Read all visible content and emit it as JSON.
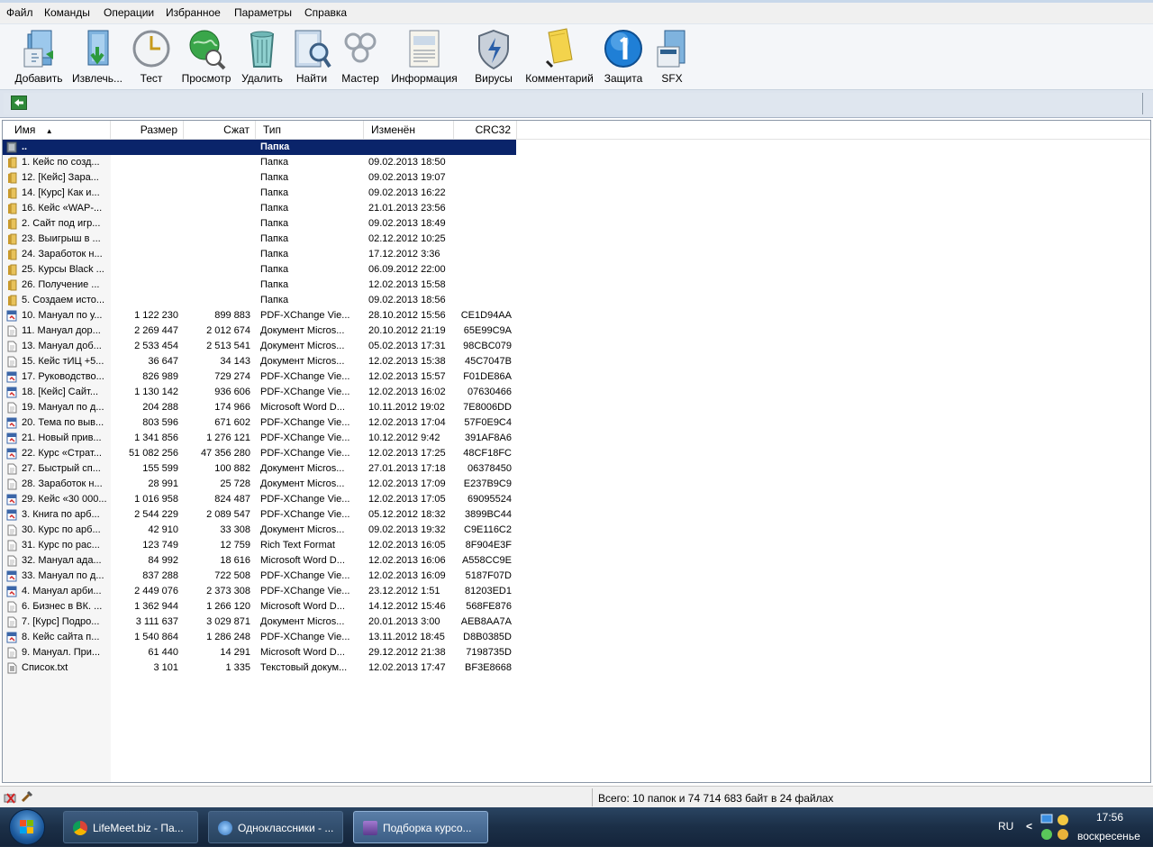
{
  "menu": [
    "Файл",
    "Команды",
    "Операции",
    "Избранное",
    "Параметры",
    "Справка"
  ],
  "toolbar": [
    {
      "label": "Добавить",
      "icon": "add-archive-icon"
    },
    {
      "label": "Извлечь...",
      "icon": "extract-icon"
    },
    {
      "label": "Тест",
      "icon": "test-clock-icon"
    },
    {
      "label": "Просмотр",
      "icon": "view-globe-icon"
    },
    {
      "label": "Удалить",
      "icon": "delete-trash-icon"
    },
    {
      "label": "Найти",
      "icon": "find-binoculars-icon"
    },
    {
      "label": "Мастер",
      "icon": "wizard-icon"
    },
    {
      "label": "Информация",
      "icon": "info-icon"
    },
    {
      "label": "Вирусы",
      "icon": "virus-shield-icon"
    },
    {
      "label": "Комментарий",
      "icon": "comment-icon"
    },
    {
      "label": "Защита",
      "icon": "protect-icon"
    },
    {
      "label": "SFX",
      "icon": "sfx-icon"
    }
  ],
  "columns": {
    "name": "Имя",
    "size": "Размер",
    "packed": "Сжат",
    "type": "Тип",
    "modified": "Изменён",
    "crc": "CRC32"
  },
  "rows": [
    {
      "name": "..",
      "size": "",
      "packed": "",
      "type": "Папка",
      "modified": "",
      "crc": "",
      "icon": "up-folder"
    },
    {
      "name": "1. Кейс по созд...",
      "size": "",
      "packed": "",
      "type": "Папка",
      "modified": "09.02.2013 18:50",
      "crc": "",
      "icon": "folder"
    },
    {
      "name": "12. [Кейс] Зара...",
      "size": "",
      "packed": "",
      "type": "Папка",
      "modified": "09.02.2013 19:07",
      "crc": "",
      "icon": "folder"
    },
    {
      "name": "14. [Курс] Как и...",
      "size": "",
      "packed": "",
      "type": "Папка",
      "modified": "09.02.2013 16:22",
      "crc": "",
      "icon": "folder"
    },
    {
      "name": "16. Кейс «WAP-...",
      "size": "",
      "packed": "",
      "type": "Папка",
      "modified": "21.01.2013 23:56",
      "crc": "",
      "icon": "folder"
    },
    {
      "name": "2. Сайт под игр...",
      "size": "",
      "packed": "",
      "type": "Папка",
      "modified": "09.02.2013 18:49",
      "crc": "",
      "icon": "folder"
    },
    {
      "name": "23. Выигрыш в ...",
      "size": "",
      "packed": "",
      "type": "Папка",
      "modified": "02.12.2012 10:25",
      "crc": "",
      "icon": "folder"
    },
    {
      "name": "24. Заработок н...",
      "size": "",
      "packed": "",
      "type": "Папка",
      "modified": "17.12.2012 3:36",
      "crc": "",
      "icon": "folder"
    },
    {
      "name": "25. Курсы Black ...",
      "size": "",
      "packed": "",
      "type": "Папка",
      "modified": "06.09.2012 22:00",
      "crc": "",
      "icon": "folder"
    },
    {
      "name": "26. Получение ...",
      "size": "",
      "packed": "",
      "type": "Папка",
      "modified": "12.02.2013 15:58",
      "crc": "",
      "icon": "folder"
    },
    {
      "name": "5. Создаем исто...",
      "size": "",
      "packed": "",
      "type": "Папка",
      "modified": "09.02.2013 18:56",
      "crc": "",
      "icon": "folder"
    },
    {
      "name": "10. Мануал по у...",
      "size": "1 122 230",
      "packed": "899 883",
      "type": "PDF-XChange Vie...",
      "modified": "28.10.2012 15:56",
      "crc": "CE1D94AA",
      "icon": "pdf"
    },
    {
      "name": "11. Мануал дор...",
      "size": "2 269 447",
      "packed": "2 012 674",
      "type": "Документ Micros...",
      "modified": "20.10.2012 21:19",
      "crc": "65E99C9A",
      "icon": "doc"
    },
    {
      "name": "13. Мануал доб...",
      "size": "2 533 454",
      "packed": "2 513 541",
      "type": "Документ Micros...",
      "modified": "05.02.2013 17:31",
      "crc": "98CBC079",
      "icon": "doc"
    },
    {
      "name": "15. Кейс тИЦ +5...",
      "size": "36 647",
      "packed": "34 143",
      "type": "Документ Micros...",
      "modified": "12.02.2013 15:38",
      "crc": "45C7047B",
      "icon": "doc"
    },
    {
      "name": "17. Руководство...",
      "size": "826 989",
      "packed": "729 274",
      "type": "PDF-XChange Vie...",
      "modified": "12.02.2013 15:57",
      "crc": "F01DE86A",
      "icon": "pdf"
    },
    {
      "name": "18. [Кейс] Сайт...",
      "size": "1 130 142",
      "packed": "936 606",
      "type": "PDF-XChange Vie...",
      "modified": "12.02.2013 16:02",
      "crc": "07630466",
      "icon": "pdf"
    },
    {
      "name": "19. Мануал по д...",
      "size": "204 288",
      "packed": "174 966",
      "type": "Microsoft Word D...",
      "modified": "10.11.2012 19:02",
      "crc": "7E8006DD",
      "icon": "doc"
    },
    {
      "name": "20. Тема по выв...",
      "size": "803 596",
      "packed": "671 602",
      "type": "PDF-XChange Vie...",
      "modified": "12.02.2013 17:04",
      "crc": "57F0E9C4",
      "icon": "pdf"
    },
    {
      "name": "21. Новый прив...",
      "size": "1 341 856",
      "packed": "1 276 121",
      "type": "PDF-XChange Vie...",
      "modified": "10.12.2012 9:42",
      "crc": "391AF8A6",
      "icon": "pdf"
    },
    {
      "name": "22. Курс «Страт...",
      "size": "51 082 256",
      "packed": "47 356 280",
      "type": "PDF-XChange Vie...",
      "modified": "12.02.2013 17:25",
      "crc": "48CF18FC",
      "icon": "pdf"
    },
    {
      "name": "27. Быстрый сп...",
      "size": "155 599",
      "packed": "100 882",
      "type": "Документ Micros...",
      "modified": "27.01.2013 17:18",
      "crc": "06378450",
      "icon": "doc"
    },
    {
      "name": "28. Заработок н...",
      "size": "28 991",
      "packed": "25 728",
      "type": "Документ Micros...",
      "modified": "12.02.2013 17:09",
      "crc": "E237B9C9",
      "icon": "doc"
    },
    {
      "name": "29. Кейс «30 000...",
      "size": "1 016 958",
      "packed": "824 487",
      "type": "PDF-XChange Vie...",
      "modified": "12.02.2013 17:05",
      "crc": "69095524",
      "icon": "pdf"
    },
    {
      "name": "3. Книга по арб...",
      "size": "2 544 229",
      "packed": "2 089 547",
      "type": "PDF-XChange Vie...",
      "modified": "05.12.2012 18:32",
      "crc": "3899BC44",
      "icon": "pdf"
    },
    {
      "name": "30. Курс по арб...",
      "size": "42 910",
      "packed": "33 308",
      "type": "Документ Micros...",
      "modified": "09.02.2013 19:32",
      "crc": "C9E116C2",
      "icon": "doc"
    },
    {
      "name": "31. Курс по рас...",
      "size": "123 749",
      "packed": "12 759",
      "type": "Rich Text Format",
      "modified": "12.02.2013 16:05",
      "crc": "8F904E3F",
      "icon": "doc"
    },
    {
      "name": "32. Мануал ада...",
      "size": "84 992",
      "packed": "18 616",
      "type": "Microsoft Word D...",
      "modified": "12.02.2013 16:06",
      "crc": "A558CC9E",
      "icon": "doc"
    },
    {
      "name": "33. Мануал по д...",
      "size": "837 288",
      "packed": "722 508",
      "type": "PDF-XChange Vie...",
      "modified": "12.02.2013 16:09",
      "crc": "5187F07D",
      "icon": "pdf"
    },
    {
      "name": "4. Мануал арби...",
      "size": "2 449 076",
      "packed": "2 373 308",
      "type": "PDF-XChange Vie...",
      "modified": "23.12.2012 1:51",
      "crc": "81203ED1",
      "icon": "pdf"
    },
    {
      "name": "6. Бизнес в ВК. ...",
      "size": "1 362 944",
      "packed": "1 266 120",
      "type": "Microsoft Word D...",
      "modified": "14.12.2012 15:46",
      "crc": "568FE876",
      "icon": "doc"
    },
    {
      "name": "7. [Курс] Подро...",
      "size": "3 111 637",
      "packed": "3 029 871",
      "type": "Документ Micros...",
      "modified": "20.01.2013 3:00",
      "crc": "AEB8AA7A",
      "icon": "doc"
    },
    {
      "name": "8. Кейс сайта п...",
      "size": "1 540 864",
      "packed": "1 286 248",
      "type": "PDF-XChange Vie...",
      "modified": "13.11.2012 18:45",
      "crc": "D8B0385D",
      "icon": "pdf"
    },
    {
      "name": "9. Мануал. При...",
      "size": "61 440",
      "packed": "14 291",
      "type": "Microsoft Word D...",
      "modified": "29.12.2012 21:38",
      "crc": "7198735D",
      "icon": "doc"
    },
    {
      "name": "Список.txt",
      "size": "3 101",
      "packed": "1 335",
      "type": "Текстовый докум...",
      "modified": "12.02.2013 17:47",
      "crc": "BF3E8668",
      "icon": "txt"
    }
  ],
  "status": {
    "text": "Всего: 10 папок и 74 714 683 байт в 24 файлах"
  },
  "taskbar": {
    "tasks": [
      {
        "label": "LifeMeet.biz - Па...",
        "icon": "chrome-icon"
      },
      {
        "label": "Одноклассники - ...",
        "icon": "browser-icon"
      },
      {
        "label": "Подборка курсо...",
        "icon": "winrar-icon"
      }
    ],
    "lang": "RU",
    "chevron": "<",
    "time": "17:56",
    "day": "воскресенье"
  }
}
